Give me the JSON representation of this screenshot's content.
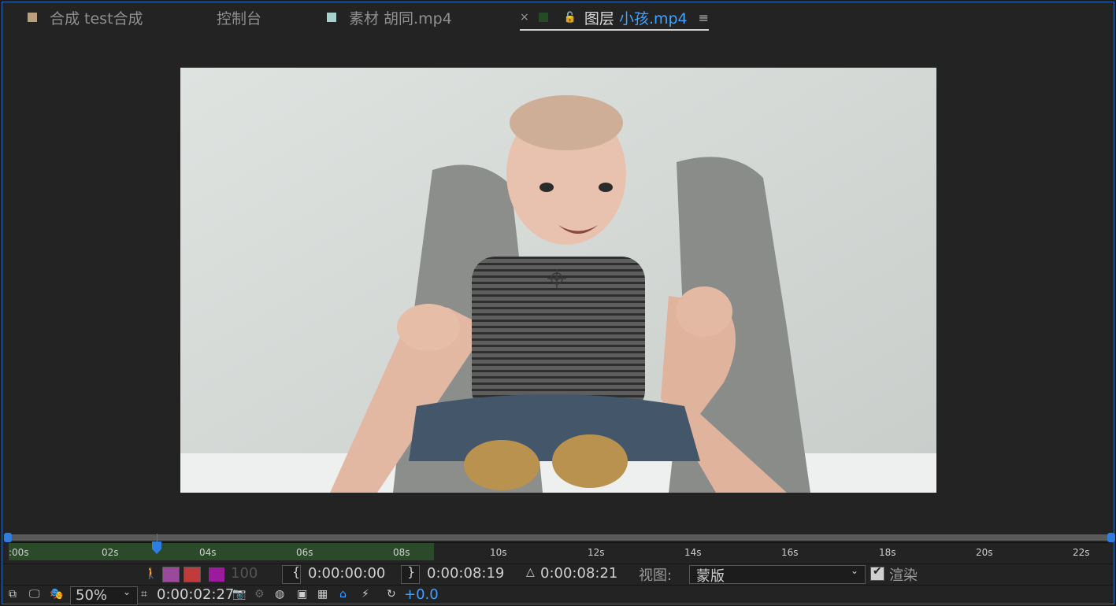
{
  "tabs": [
    {
      "label": "合成 test合成",
      "swatch": "#b8a07c"
    },
    {
      "label": "控制台"
    },
    {
      "label": "素材 胡同.mp4",
      "swatch": "#a8d0cc"
    },
    {
      "label": "图层",
      "file": "小孩.mp4",
      "swatch": "#244a26",
      "close": "×",
      "lock": "🔓",
      "menu": "≡"
    }
  ],
  "ruler": {
    "labels": [
      ":00s",
      "02s",
      "04s",
      "06s",
      "08s",
      "10s",
      "12s",
      "14s",
      "16s",
      "18s",
      "20s",
      "22s"
    ]
  },
  "controls": {
    "opacity": "100",
    "in_point": "0:00:00:00",
    "out_point": "0:00:08:19",
    "duration": "0:00:08:21",
    "view_label": "视图:",
    "view_value": "蒙版",
    "render_label": "渲染",
    "zoom": "50%",
    "current_time": "0:00:02:27",
    "exposure": "+0.0",
    "delta": "△",
    "in_bracket": "{",
    "out_bracket": "}"
  },
  "colors": {
    "accent": "#2e7de0",
    "work_area": "#2a4a2a"
  }
}
